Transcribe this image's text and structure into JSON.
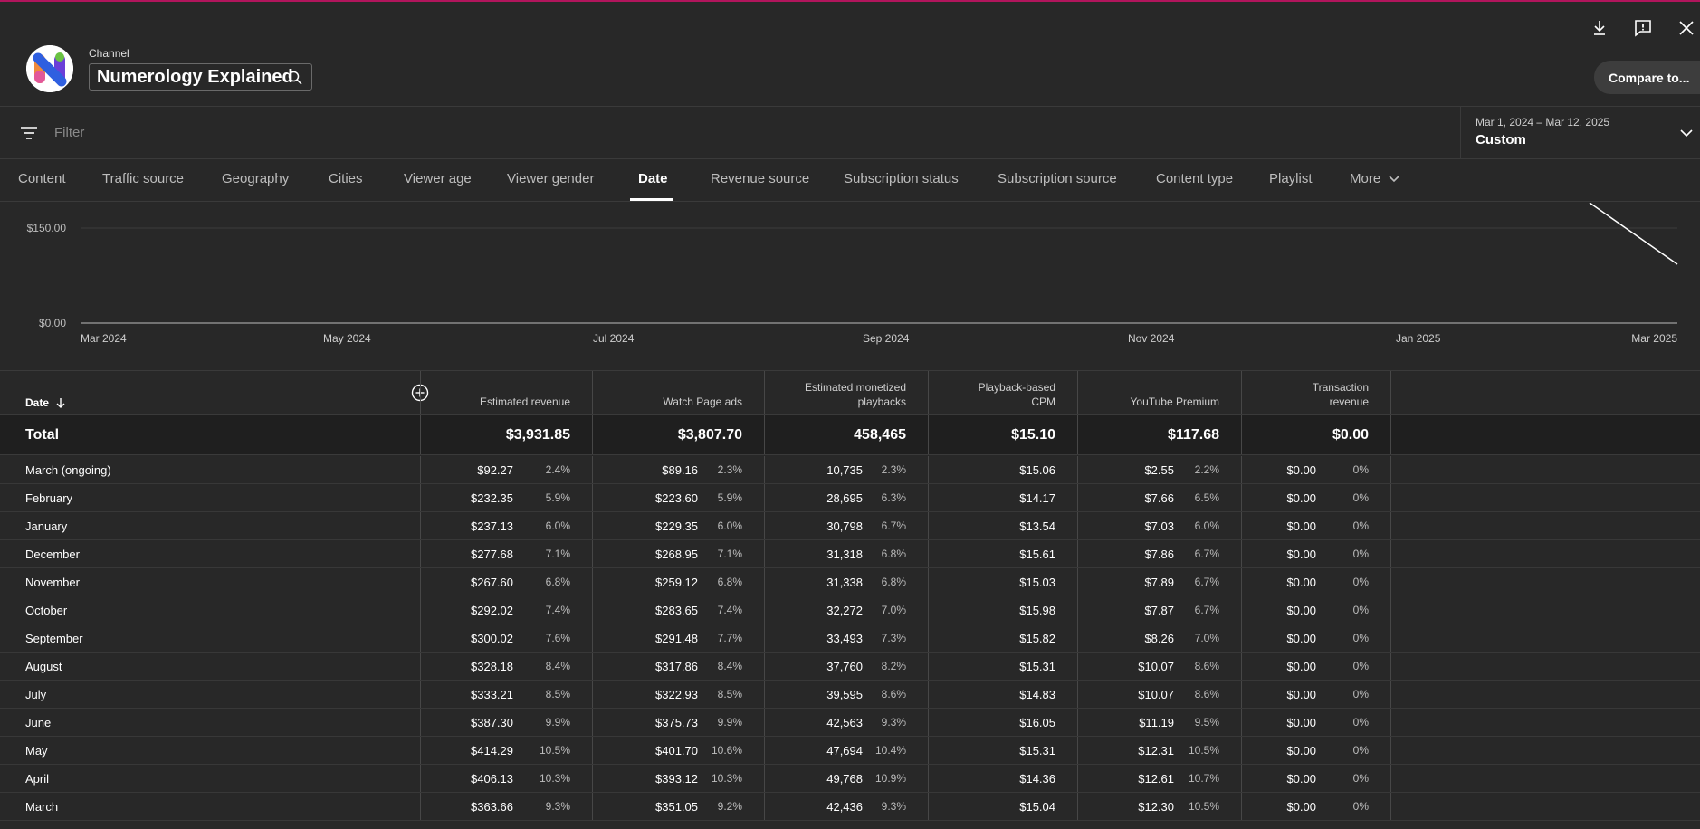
{
  "header": {
    "channel_label": "Channel",
    "channel_name": "Numerology Explained",
    "compare_label": "Compare to..."
  },
  "filterbar": {
    "placeholder": "Filter",
    "date_range_dates": "Mar 1, 2024 – Mar 12, 2025",
    "date_range_label": "Custom"
  },
  "tabs": [
    "Content",
    "Traffic source",
    "Geography",
    "Cities",
    "Viewer age",
    "Viewer gender",
    "Date",
    "Revenue source",
    "Subscription status",
    "Subscription source",
    "Content type",
    "Playlist",
    "More"
  ],
  "active_tab": "Date",
  "chart_data": {
    "type": "line",
    "x_ticks": [
      "Mar 2024",
      "May 2024",
      "Jul 2024",
      "Sep 2024",
      "Nov 2024",
      "Jan 2025",
      "Mar 2025"
    ],
    "y_ticks": [
      "$150.00",
      "$0.00"
    ],
    "ylim": [
      0,
      150
    ],
    "grid": true
  },
  "table": {
    "columns": {
      "date": "Date",
      "estimated_revenue": "Estimated revenue",
      "watch_page_ads": "Watch Page ads",
      "monetized_playbacks_1": "Estimated monetized",
      "monetized_playbacks_2": "playbacks",
      "cpm_1": "Playback-based",
      "cpm_2": "CPM",
      "youtube_premium": "YouTube Premium",
      "transaction_1": "Transaction",
      "transaction_2": "revenue"
    },
    "total": {
      "label": "Total",
      "estimated_revenue": "$3,931.85",
      "watch_page_ads": "$3,807.70",
      "monetized_playbacks": "458,465",
      "cpm": "$15.10",
      "youtube_premium": "$117.68",
      "transaction_revenue": "$0.00"
    },
    "rows": [
      {
        "date": "March (ongoing)",
        "rev": "$92.27",
        "rev_pct": "2.4%",
        "ads": "$89.16",
        "ads_pct": "2.3%",
        "plays": "10,735",
        "plays_pct": "2.3%",
        "cpm": "$15.06",
        "prem": "$2.55",
        "prem_pct": "2.2%",
        "trans": "$0.00",
        "trans_pct": "0%"
      },
      {
        "date": "February",
        "rev": "$232.35",
        "rev_pct": "5.9%",
        "ads": "$223.60",
        "ads_pct": "5.9%",
        "plays": "28,695",
        "plays_pct": "6.3%",
        "cpm": "$14.17",
        "prem": "$7.66",
        "prem_pct": "6.5%",
        "trans": "$0.00",
        "trans_pct": "0%"
      },
      {
        "date": "January",
        "rev": "$237.13",
        "rev_pct": "6.0%",
        "ads": "$229.35",
        "ads_pct": "6.0%",
        "plays": "30,798",
        "plays_pct": "6.7%",
        "cpm": "$13.54",
        "prem": "$7.03",
        "prem_pct": "6.0%",
        "trans": "$0.00",
        "trans_pct": "0%"
      },
      {
        "date": "December",
        "rev": "$277.68",
        "rev_pct": "7.1%",
        "ads": "$268.95",
        "ads_pct": "7.1%",
        "plays": "31,318",
        "plays_pct": "6.8%",
        "cpm": "$15.61",
        "prem": "$7.86",
        "prem_pct": "6.7%",
        "trans": "$0.00",
        "trans_pct": "0%"
      },
      {
        "date": "November",
        "rev": "$267.60",
        "rev_pct": "6.8%",
        "ads": "$259.12",
        "ads_pct": "6.8%",
        "plays": "31,338",
        "plays_pct": "6.8%",
        "cpm": "$15.03",
        "prem": "$7.89",
        "prem_pct": "6.7%",
        "trans": "$0.00",
        "trans_pct": "0%"
      },
      {
        "date": "October",
        "rev": "$292.02",
        "rev_pct": "7.4%",
        "ads": "$283.65",
        "ads_pct": "7.4%",
        "plays": "32,272",
        "plays_pct": "7.0%",
        "cpm": "$15.98",
        "prem": "$7.87",
        "prem_pct": "6.7%",
        "trans": "$0.00",
        "trans_pct": "0%"
      },
      {
        "date": "September",
        "rev": "$300.02",
        "rev_pct": "7.6%",
        "ads": "$291.48",
        "ads_pct": "7.7%",
        "plays": "33,493",
        "plays_pct": "7.3%",
        "cpm": "$15.82",
        "prem": "$8.26",
        "prem_pct": "7.0%",
        "trans": "$0.00",
        "trans_pct": "0%"
      },
      {
        "date": "August",
        "rev": "$328.18",
        "rev_pct": "8.4%",
        "ads": "$317.86",
        "ads_pct": "8.4%",
        "plays": "37,760",
        "plays_pct": "8.2%",
        "cpm": "$15.31",
        "prem": "$10.07",
        "prem_pct": "8.6%",
        "trans": "$0.00",
        "trans_pct": "0%"
      },
      {
        "date": "July",
        "rev": "$333.21",
        "rev_pct": "8.5%",
        "ads": "$322.93",
        "ads_pct": "8.5%",
        "plays": "39,595",
        "plays_pct": "8.6%",
        "cpm": "$14.83",
        "prem": "$10.07",
        "prem_pct": "8.6%",
        "trans": "$0.00",
        "trans_pct": "0%"
      },
      {
        "date": "June",
        "rev": "$387.30",
        "rev_pct": "9.9%",
        "ads": "$375.73",
        "ads_pct": "9.9%",
        "plays": "42,563",
        "plays_pct": "9.3%",
        "cpm": "$16.05",
        "prem": "$11.19",
        "prem_pct": "9.5%",
        "trans": "$0.00",
        "trans_pct": "0%"
      },
      {
        "date": "May",
        "rev": "$414.29",
        "rev_pct": "10.5%",
        "ads": "$401.70",
        "ads_pct": "10.6%",
        "plays": "47,694",
        "plays_pct": "10.4%",
        "cpm": "$15.31",
        "prem": "$12.31",
        "prem_pct": "10.5%",
        "trans": "$0.00",
        "trans_pct": "0%"
      },
      {
        "date": "April",
        "rev": "$406.13",
        "rev_pct": "10.3%",
        "ads": "$393.12",
        "ads_pct": "10.3%",
        "plays": "49,768",
        "plays_pct": "10.9%",
        "cpm": "$14.36",
        "prem": "$12.61",
        "prem_pct": "10.7%",
        "trans": "$0.00",
        "trans_pct": "0%"
      },
      {
        "date": "March",
        "rev": "$363.66",
        "rev_pct": "9.3%",
        "ads": "$351.05",
        "ads_pct": "9.2%",
        "plays": "42,436",
        "plays_pct": "9.3%",
        "cpm": "$15.04",
        "prem": "$12.30",
        "prem_pct": "10.5%",
        "trans": "$0.00",
        "trans_pct": "0%"
      }
    ]
  }
}
